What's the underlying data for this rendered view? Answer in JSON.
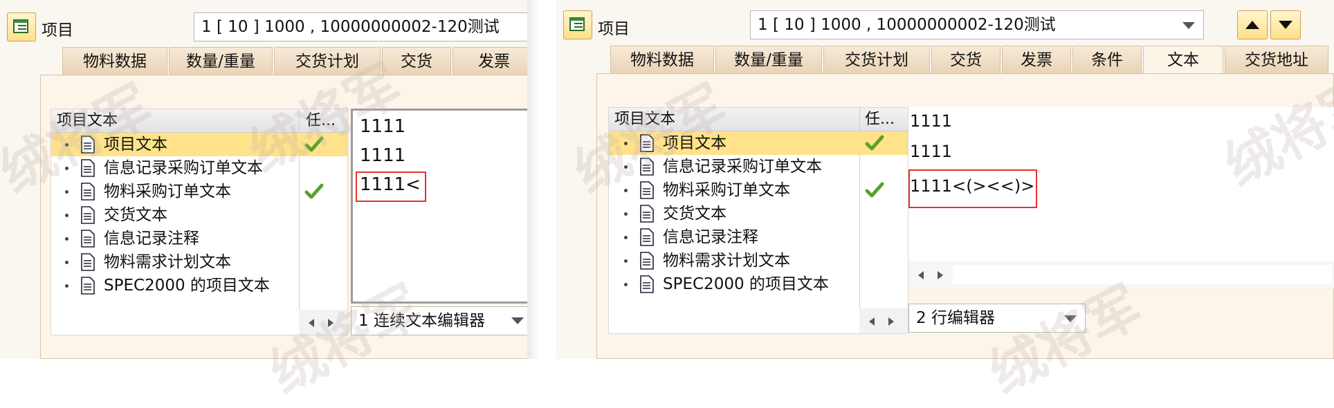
{
  "left": {
    "item_label": "项目",
    "item_value": "1 [ 10 ] 1000 , 10000000002-120测试",
    "tabs": [
      "物料数据",
      "数量/重量",
      "交货计划",
      "交货",
      "发票"
    ],
    "tree": {
      "col_text": "项目文本",
      "col_task": "任...",
      "items": [
        {
          "label": "项目文本",
          "checked": true,
          "selected": true
        },
        {
          "label": "信息记录采购订单文本",
          "checked": false,
          "selected": false
        },
        {
          "label": "物料采购订单文本",
          "checked": true,
          "selected": false
        },
        {
          "label": "交货文本",
          "checked": false,
          "selected": false
        },
        {
          "label": "信息记录注释",
          "checked": false,
          "selected": false
        },
        {
          "label": "物料需求计划文本",
          "checked": false,
          "selected": false
        },
        {
          "label": "SPEC2000 的项目文本",
          "checked": false,
          "selected": false
        }
      ]
    },
    "editor_lines": [
      "1111",
      "1111",
      "1111<"
    ],
    "editor_mode": "1 连续文本编辑器"
  },
  "right": {
    "item_label": "项目",
    "item_value": "1 [ 10 ] 1000 , 10000000002-120测试",
    "tabs": [
      "物料数据",
      "数量/重量",
      "交货计划",
      "交货",
      "发票",
      "条件",
      "文本",
      "交货地址"
    ],
    "active_tab": "文本",
    "tree": {
      "col_text": "项目文本",
      "col_task": "任...",
      "items": [
        {
          "label": "项目文本",
          "checked": true,
          "selected": true
        },
        {
          "label": "信息记录采购订单文本",
          "checked": false,
          "selected": false
        },
        {
          "label": "物料采购订单文本",
          "checked": true,
          "selected": false
        },
        {
          "label": "交货文本",
          "checked": false,
          "selected": false
        },
        {
          "label": "信息记录注释",
          "checked": false,
          "selected": false
        },
        {
          "label": "物料需求计划文本",
          "checked": false,
          "selected": false
        },
        {
          "label": "SPEC2000 的项目文本",
          "checked": false,
          "selected": false
        }
      ]
    },
    "editor_lines": [
      "1111",
      "1111",
      "1111<(><<)>"
    ],
    "editor_mode": "2 行编辑器"
  },
  "watermark_text": "绒将军",
  "colors": {
    "highlight": "#ffe28a",
    "check": "#5aa02c",
    "redbox": "#e5312d"
  }
}
